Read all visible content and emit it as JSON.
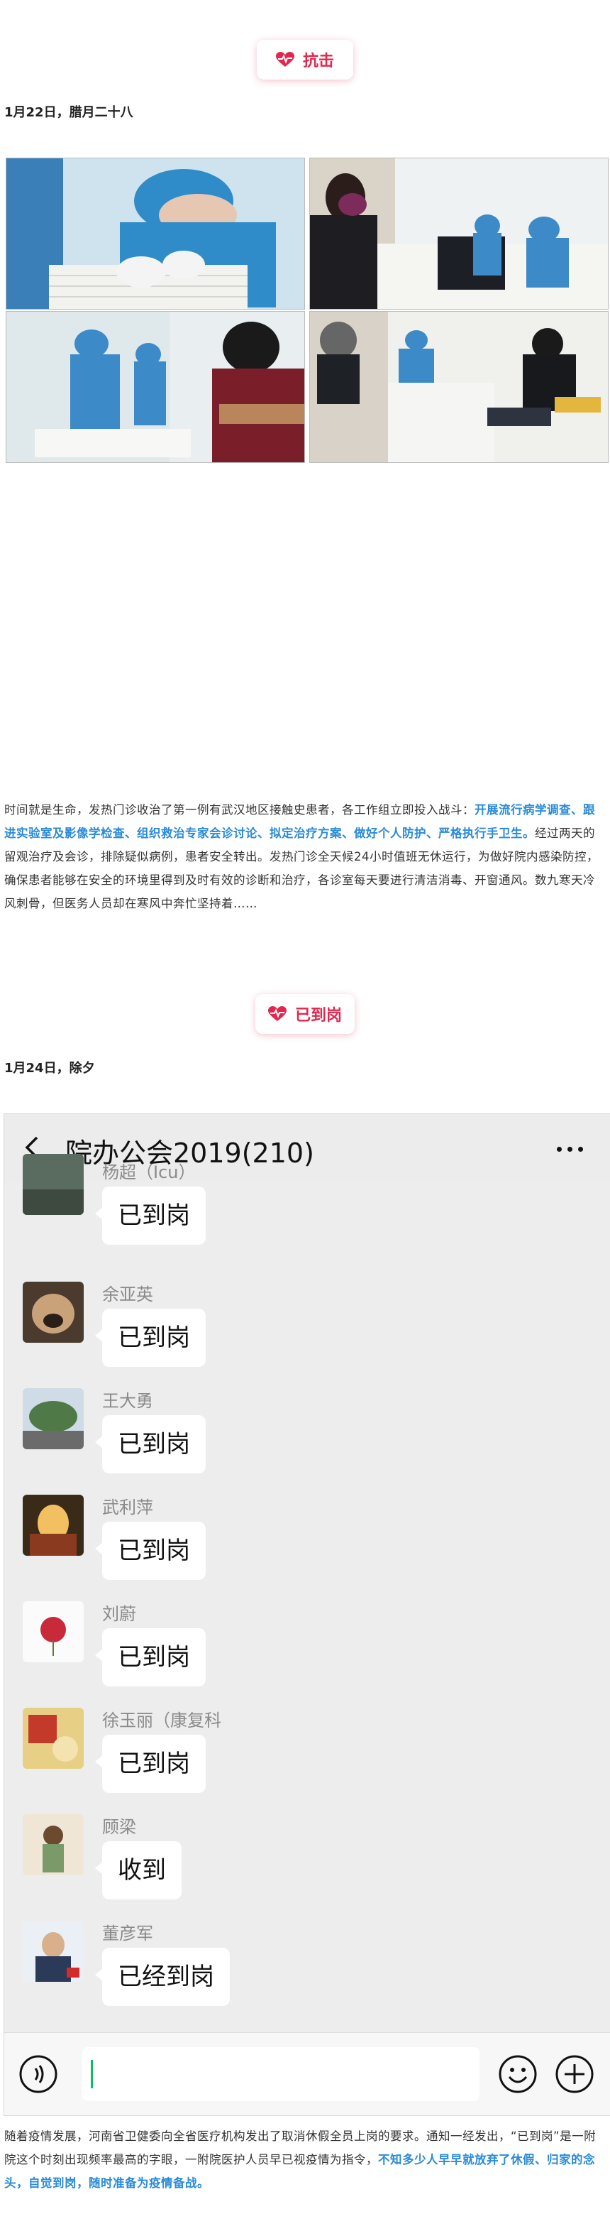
{
  "section1": {
    "pill": "抗击",
    "date": "1月22日，腊月二十八"
  },
  "paragraph1": {
    "intro": "时间就是生命，发热门诊收治了第一例有武汉地区接触史患者，各工作组立即投入战斗：",
    "highlight": "开展流行病学调查、跟进实验室及影像学检查、组织救治专家会诊讨论、拟定治疗方案、做好个人防护、严格执行手卫生。",
    "rest": "经过两天的留观治疗及会诊，排除疑似病例，患者安全转出。发热门诊全天候24小时值班无休运行，为做好院内感染防控，确保患者能够在安全的环境里得到及时有效的诊断和治疗，各诊室每天要进行清洁消毒、开窗通风。数九寒天冷风刺骨，但医务人员却在寒风中奔忙坚持着……"
  },
  "section2": {
    "pill": "已到岗",
    "date": "1月24日，除夕"
  },
  "chat": {
    "title": "院办公会2019(210)",
    "messages": [
      {
        "name": "杨超（Icu）",
        "text": "已到岗"
      },
      {
        "name": "余亚英",
        "text": "已到岗"
      },
      {
        "name": "王大勇",
        "text": "已到岗"
      },
      {
        "name": "武利萍",
        "text": "已到岗"
      },
      {
        "name": "刘蔚",
        "text": "已到岗"
      },
      {
        "name": "徐玉丽（康复科",
        "text": "已到岗"
      },
      {
        "name": "顾梁",
        "text": "收到"
      },
      {
        "name": "董彦军",
        "text": "已经到岗"
      }
    ]
  },
  "paragraph2": {
    "intro": "随着疫情发展，河南省卫健委向全省医疗机构发出了取消休假全员上岗的要求。通知一经发出，“已到岗”是一附院这个时刻出现频率最高的字眼，一附院医护人员早已视疫情为指令，",
    "highlight": "不知多少人早早就放弃了休假、归家的念头，自觉到岗，随时准备为疫情备战。"
  },
  "colors": {
    "accent": "#e2264d",
    "link": "#2a8bd8"
  }
}
